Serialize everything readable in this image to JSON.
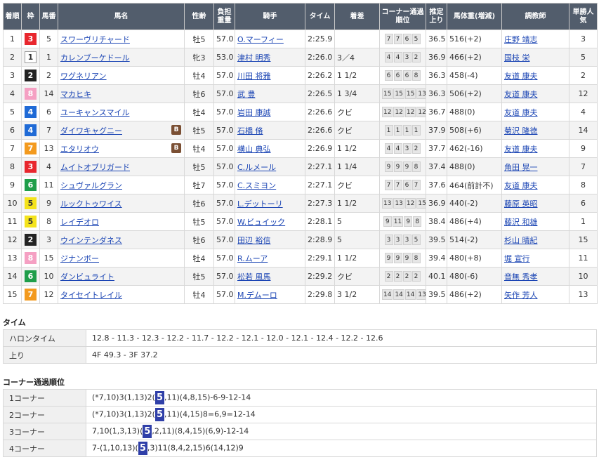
{
  "headers": [
    "着順",
    "枠",
    "馬番",
    "馬名",
    "性齢",
    "負担重量",
    "騎手",
    "タイム",
    "着差",
    "コーナー通過順位",
    "推定上り",
    "馬体重(増減)",
    "調教師",
    "単勝人気"
  ],
  "rows": [
    {
      "rank": "1",
      "waku": "3",
      "num": "5",
      "name": "スワーヴリチャード",
      "blinker": "",
      "sex": "牡5",
      "weight": "57.0",
      "jockey": "O.マーフィー",
      "time": "2:25.9",
      "margin": "",
      "corner": [
        "7",
        "7",
        "6",
        "5"
      ],
      "agari": "36.5",
      "body": "516(+2)",
      "trainer": "庄野 靖志",
      "pop": "3"
    },
    {
      "rank": "2",
      "waku": "1",
      "num": "1",
      "name": "カレンブーケドール",
      "blinker": "",
      "sex": "牝3",
      "weight": "53.0",
      "jockey": "津村 明秀",
      "time": "2:26.0",
      "margin": "3／4",
      "corner": [
        "4",
        "4",
        "3",
        "2"
      ],
      "agari": "36.9",
      "body": "466(+2)",
      "trainer": "国枝 栄",
      "pop": "5"
    },
    {
      "rank": "3",
      "waku": "2",
      "num": "2",
      "name": "ワグネリアン",
      "blinker": "",
      "sex": "牡4",
      "weight": "57.0",
      "jockey": "川田 将雅",
      "time": "2:26.2",
      "margin": "1 1/2",
      "corner": [
        "6",
        "6",
        "6",
        "8"
      ],
      "agari": "36.3",
      "body": "458(-4)",
      "trainer": "友道 康夫",
      "pop": "2"
    },
    {
      "rank": "4",
      "waku": "8",
      "num": "14",
      "name": "マカヒキ",
      "blinker": "",
      "sex": "牡6",
      "weight": "57.0",
      "jockey": "武 豊",
      "time": "2:26.5",
      "margin": "1 3/4",
      "corner": [
        "15",
        "15",
        "15",
        "13"
      ],
      "agari": "36.3",
      "body": "506(+2)",
      "trainer": "友道 康夫",
      "pop": "12"
    },
    {
      "rank": "5",
      "waku": "4",
      "num": "6",
      "name": "ユーキャンスマイル",
      "blinker": "",
      "sex": "牡4",
      "weight": "57.0",
      "jockey": "岩田 康誠",
      "time": "2:26.6",
      "margin": "クビ",
      "corner": [
        "12",
        "12",
        "12",
        "12"
      ],
      "agari": "36.7",
      "body": "488(0)",
      "trainer": "友道 康夫",
      "pop": "4"
    },
    {
      "rank": "6",
      "waku": "4",
      "num": "7",
      "name": "ダイワキャグニー",
      "blinker": "B",
      "sex": "牡5",
      "weight": "57.0",
      "jockey": "石橋 脩",
      "time": "2:26.6",
      "margin": "クビ",
      "corner": [
        "1",
        "1",
        "1",
        "1"
      ],
      "agari": "37.9",
      "body": "508(+6)",
      "trainer": "菊沢 隆徳",
      "pop": "14"
    },
    {
      "rank": "7",
      "waku": "7",
      "num": "13",
      "name": "エタリオウ",
      "blinker": "B",
      "sex": "牡4",
      "weight": "57.0",
      "jockey": "横山 典弘",
      "time": "2:26.9",
      "margin": "1 1/2",
      "corner": [
        "4",
        "4",
        "3",
        "2"
      ],
      "agari": "37.7",
      "body": "462(-16)",
      "trainer": "友道 康夫",
      "pop": "9"
    },
    {
      "rank": "8",
      "waku": "3",
      "num": "4",
      "name": "ムイトオブリガード",
      "blinker": "",
      "sex": "牡5",
      "weight": "57.0",
      "jockey": "C.ルメール",
      "time": "2:27.1",
      "margin": "1 1/4",
      "corner": [
        "9",
        "9",
        "9",
        "8"
      ],
      "agari": "37.4",
      "body": "488(0)",
      "trainer": "角田 晃一",
      "pop": "7"
    },
    {
      "rank": "9",
      "waku": "6",
      "num": "11",
      "name": "シュヴァルグラン",
      "blinker": "",
      "sex": "牡7",
      "weight": "57.0",
      "jockey": "C.スミヨン",
      "time": "2:27.1",
      "margin": "クビ",
      "corner": [
        "7",
        "7",
        "6",
        "7"
      ],
      "agari": "37.6",
      "body": "464(前計不)",
      "trainer": "友道 康夫",
      "pop": "8"
    },
    {
      "rank": "10",
      "waku": "5",
      "num": "9",
      "name": "ルックトゥワイス",
      "blinker": "",
      "sex": "牡6",
      "weight": "57.0",
      "jockey": "L.デットーリ",
      "time": "2:27.3",
      "margin": "1 1/2",
      "corner": [
        "13",
        "13",
        "12",
        "15"
      ],
      "agari": "36.9",
      "body": "440(-2)",
      "trainer": "藤原 英昭",
      "pop": "6"
    },
    {
      "rank": "11",
      "waku": "5",
      "num": "8",
      "name": "レイデオロ",
      "blinker": "",
      "sex": "牡5",
      "weight": "57.0",
      "jockey": "W.ビュイック",
      "time": "2:28.1",
      "margin": "5",
      "corner": [
        "9",
        "11",
        "9",
        "8"
      ],
      "agari": "38.4",
      "body": "486(+4)",
      "trainer": "藤沢 和雄",
      "pop": "1"
    },
    {
      "rank": "12",
      "waku": "2",
      "num": "3",
      "name": "ウインテンダネス",
      "blinker": "",
      "sex": "牡6",
      "weight": "57.0",
      "jockey": "田辺 裕信",
      "time": "2:28.9",
      "margin": "5",
      "corner": [
        "3",
        "3",
        "3",
        "5"
      ],
      "agari": "39.5",
      "body": "514(-2)",
      "trainer": "杉山 晴紀",
      "pop": "15"
    },
    {
      "rank": "13",
      "waku": "8",
      "num": "15",
      "name": "ジナンボー",
      "blinker": "",
      "sex": "牡4",
      "weight": "57.0",
      "jockey": "R.ムーア",
      "time": "2:29.1",
      "margin": "1 1/2",
      "corner": [
        "9",
        "9",
        "9",
        "8"
      ],
      "agari": "39.4",
      "body": "480(+8)",
      "trainer": "堀 宣行",
      "pop": "11"
    },
    {
      "rank": "14",
      "waku": "6",
      "num": "10",
      "name": "ダンビュライト",
      "blinker": "",
      "sex": "牡5",
      "weight": "57.0",
      "jockey": "松若 風馬",
      "time": "2:29.2",
      "margin": "クビ",
      "corner": [
        "2",
        "2",
        "2",
        "2"
      ],
      "agari": "40.1",
      "body": "480(-6)",
      "trainer": "音無 秀孝",
      "pop": "10"
    },
    {
      "rank": "15",
      "waku": "7",
      "num": "12",
      "name": "タイセイトレイル",
      "blinker": "",
      "sex": "牡4",
      "weight": "57.0",
      "jockey": "M.デムーロ",
      "time": "2:29.8",
      "margin": "3 1/2",
      "corner": [
        "14",
        "14",
        "14",
        "13"
      ],
      "agari": "39.5",
      "body": "486(+2)",
      "trainer": "矢作 芳人",
      "pop": "13"
    }
  ],
  "time_section": {
    "title": "タイム",
    "rows": [
      {
        "label": "ハロンタイム",
        "value": "12.8 - 11.3 - 12.3 - 12.2 - 11.7 - 12.2 - 12.1 - 12.0 - 12.1 - 12.4 - 12.2 - 12.6"
      },
      {
        "label": "上り",
        "value": "4F 49.3 - 3F 37.2"
      }
    ]
  },
  "corner_section": {
    "title": "コーナー通過順位",
    "rows": [
      {
        "label": "1コーナー",
        "before": "(*7,10)3(1,13)2(",
        "hl": "5",
        "after": ",11)(4,8,15)-6-9-12-14"
      },
      {
        "label": "2コーナー",
        "before": "(*7,10)3(1,13)2(",
        "hl": "5",
        "after": ",11)(4,15)8=6,9=12-14"
      },
      {
        "label": "3コーナー",
        "before": "7,10(1,3,13)(",
        "hl": "5",
        "after": ",2,11)(8,4,15)(6,9)-12-14"
      },
      {
        "label": "4コーナー",
        "before": "7-(1,10,13)(",
        "hl": "5",
        "after": ",3)11(8,4,2,15)6(14,12)9"
      }
    ]
  }
}
